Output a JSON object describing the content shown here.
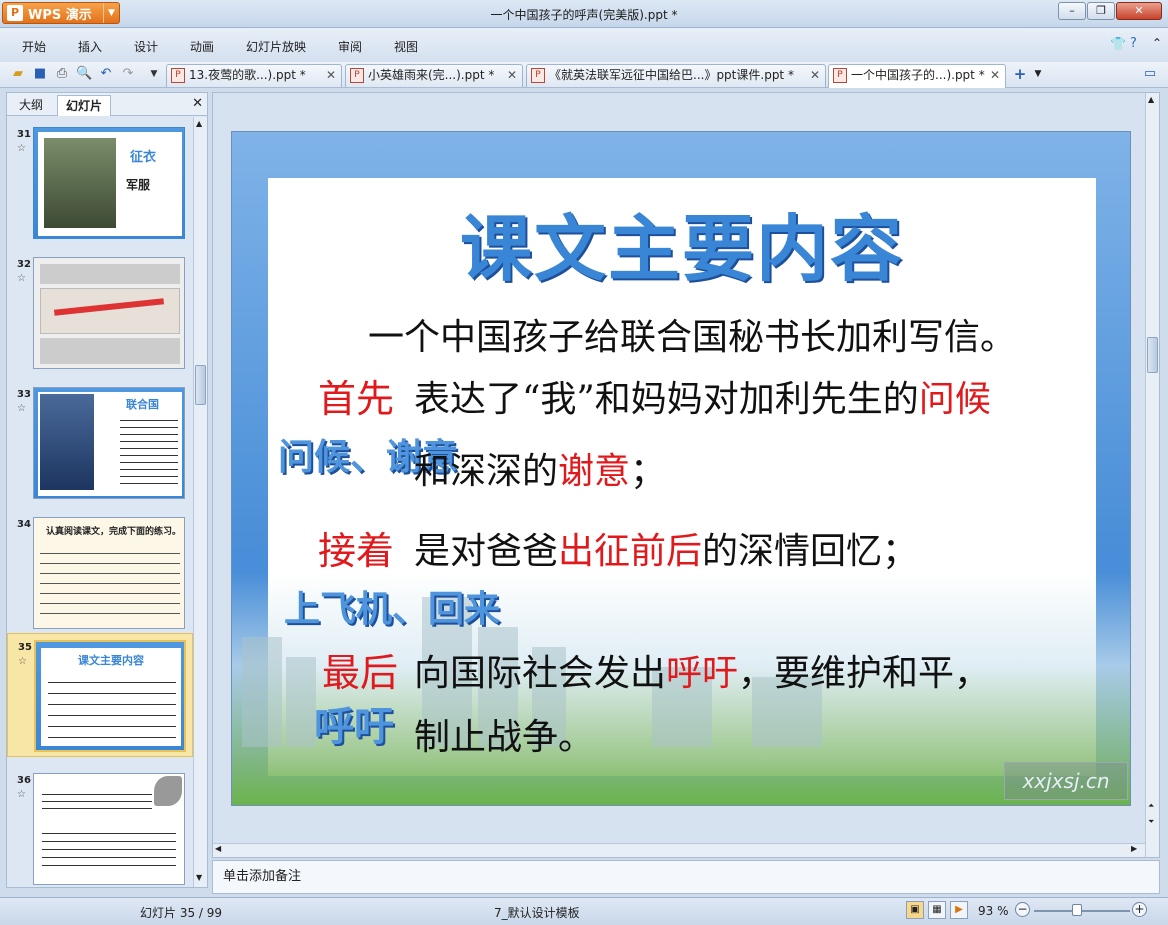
{
  "app": {
    "button_label": "WPS 演示",
    "window_title": "一个中国孩子的呼声(完美版).ppt *"
  },
  "menu": [
    "开始",
    "插入",
    "设计",
    "动画",
    "幻灯片放映",
    "审阅",
    "视图"
  ],
  "tabs": [
    {
      "label": "13.夜莺的歌...).ppt *",
      "active": false
    },
    {
      "label": "小英雄雨来(完...).ppt *",
      "active": false
    },
    {
      "label": "《就英法联军远征中国给巴...》ppt课件.ppt *",
      "active": false
    },
    {
      "label": "一个中国孩子的...).ppt *",
      "active": true
    }
  ],
  "left_panel": {
    "tab_outline": "大纲",
    "tab_slides": "幻灯片",
    "thumbnails": [
      {
        "num": "31",
        "title": "征衣",
        "subtitle": "军服"
      },
      {
        "num": "32"
      },
      {
        "num": "33",
        "title": "联合国"
      },
      {
        "num": "34",
        "title": "认真阅读课文，完成下面的练习。"
      },
      {
        "num": "35",
        "title": "课文主要内容",
        "selected": true
      },
      {
        "num": "36"
      }
    ]
  },
  "slide": {
    "title": "课文主要内容",
    "intro": "一个中国孩子给联合国秘书长加利写信。",
    "first_label": "首先",
    "first_text_a": "表达了“我”和妈妈对加利先生的",
    "first_red_a": "问候",
    "first_text_b": "和深深的",
    "first_red_b": "谢意",
    "first_text_c": "；",
    "wordart_1": "问候、谢意",
    "next_label": "接着",
    "next_text_a": "是对爸爸",
    "next_red": "出征前后",
    "next_text_b": "的深情回忆；",
    "wordart_2": "上飞机、回来",
    "last_label": "最后",
    "last_text_a": "向国际社会发出",
    "last_red": "呼吁",
    "last_text_b": "，要维护和平，",
    "last_text_c": "制止战争。",
    "wordart_3": "呼吁",
    "watermark": "xxjxsj.cn"
  },
  "notes_placeholder": "单击添加备注",
  "status": {
    "slide_counter": "幻灯片 35 / 99",
    "template": "7_默认设计模板",
    "zoom": "93 %"
  }
}
